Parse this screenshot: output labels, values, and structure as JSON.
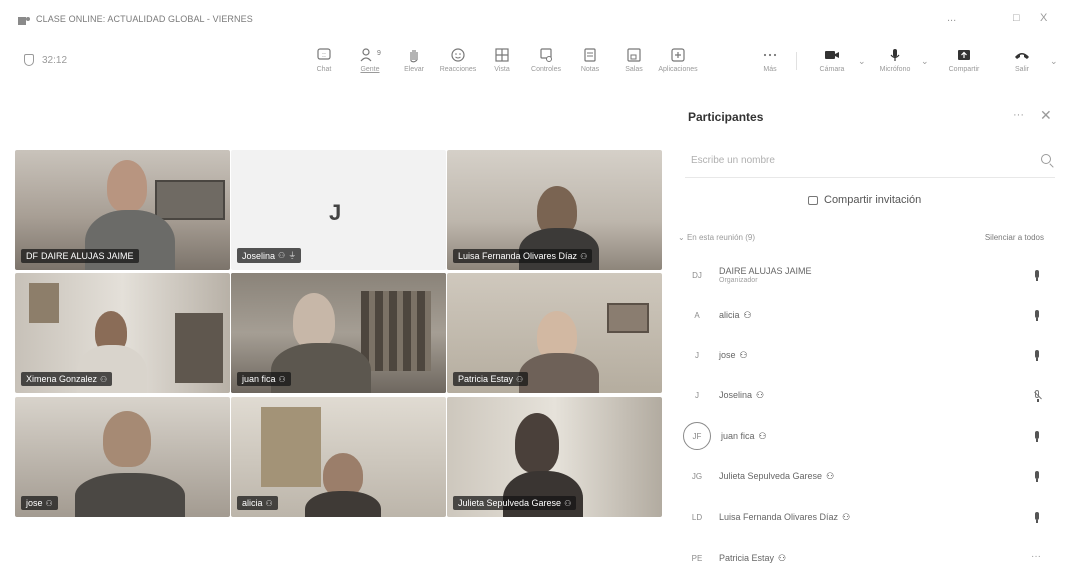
{
  "window": {
    "title": "CLASE ONLINE: ACTUALIDAD GLOBAL - VIERNES",
    "controls": [
      "...",
      "□",
      "X"
    ]
  },
  "meeting": {
    "timer": "32:12"
  },
  "toolbar": {
    "items": [
      {
        "label": "Chat",
        "icon": "chat-icon"
      },
      {
        "label": "Gente",
        "badge": "9",
        "icon": "people-icon",
        "active": true
      },
      {
        "label": "Elevar",
        "icon": "raise-hand-icon"
      },
      {
        "label": "Reacciones",
        "icon": "emoji-icon"
      },
      {
        "label": "Vista",
        "icon": "grid-view-icon"
      },
      {
        "label": "Controles",
        "icon": "controls-icon"
      },
      {
        "label": "Notas",
        "icon": "notes-icon"
      },
      {
        "label": "Salas",
        "icon": "rooms-icon"
      },
      {
        "label": "Aplicaciones",
        "icon": "apps-icon"
      },
      {
        "label": "Más",
        "icon": "more-icon"
      }
    ],
    "camera": "Cámara",
    "mic": "Micrófono",
    "share": "Compartir",
    "leave": "Salir"
  },
  "videos": [
    {
      "name": "DAIRE ALUJAS JAIME",
      "prefix": "DF"
    },
    {
      "name": "Joselina",
      "initial": "J"
    },
    {
      "name": "Luisa Fernanda Olivares Díaz"
    },
    {
      "name": "Ximena Gonzalez"
    },
    {
      "name": "juan fica"
    },
    {
      "name": "Patricia Estay"
    },
    {
      "name": "jose"
    },
    {
      "name": "alicia"
    },
    {
      "name": "Julieta Sepulveda Garese"
    }
  ],
  "panel": {
    "title": "Participantes",
    "search_placeholder": "Escribe un nombre",
    "share_invite": "Compartir invitación",
    "section_label": "En esta reunión (9)",
    "mute_all": "Silenciar a todos",
    "participants": [
      {
        "initials": "DJ",
        "name": "DAIRE ALUJAS JAIME",
        "role": "Organizador",
        "mic": "on"
      },
      {
        "initials": "A",
        "name": "alicia",
        "mic": "on"
      },
      {
        "initials": "J",
        "name": "jose",
        "mic": "on"
      },
      {
        "initials": "J",
        "name": "Joselina",
        "mic": "off"
      },
      {
        "initials": "JF",
        "name": "juan fica",
        "mic": "on"
      },
      {
        "initials": "JG",
        "name": "Julieta Sepulveda Garese",
        "mic": "on"
      },
      {
        "initials": "LD",
        "name": "Luisa Fernanda Olivares Díaz",
        "mic": "on"
      },
      {
        "initials": "PE",
        "name": "Patricia Estay",
        "mic": "more"
      }
    ]
  }
}
